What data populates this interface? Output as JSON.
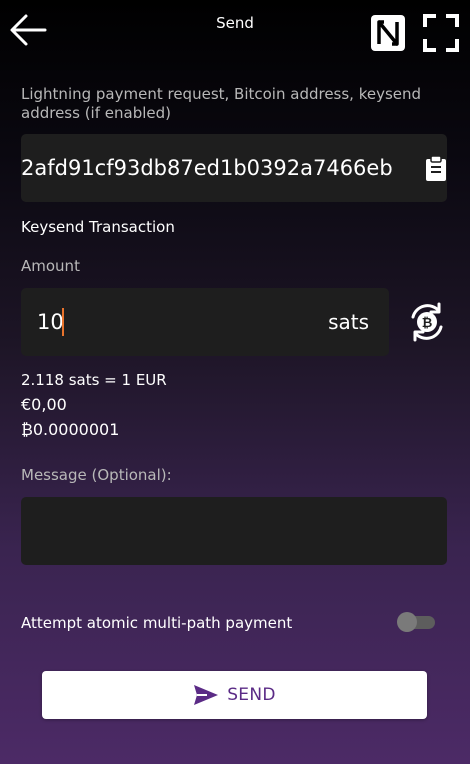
{
  "header": {
    "title": "Send",
    "back_icon": "arrow-left-icon",
    "nfc_icon": "nfc-icon",
    "scan_icon": "scan-frame-icon"
  },
  "destination": {
    "label": "Lightning payment request, Bitcoin address, keysend address (if enabled)",
    "value": "2afd91cf93db87ed1b0392a7466eb",
    "paste_icon": "clipboard-icon"
  },
  "transaction_type": "Keysend Transaction",
  "amount": {
    "label": "Amount",
    "value": "10",
    "unit": "sats",
    "swap_icon": "bitcoin-swap-icon"
  },
  "conversion": {
    "rate": "2.118 sats = 1 EUR",
    "fiat": "€0,00",
    "btc": "₿0.0000001"
  },
  "message": {
    "label": "Message (Optional):",
    "value": ""
  },
  "amp": {
    "label": "Attempt atomic multi-path payment",
    "enabled": false
  },
  "send_button": {
    "label": "SEND",
    "icon": "send-icon"
  },
  "colors": {
    "accent": "#5b2b86",
    "caret": "#e8732c",
    "field_bg": "#1e1e1e"
  }
}
